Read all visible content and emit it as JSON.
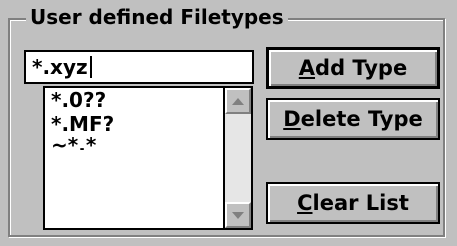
{
  "group": {
    "title": "User defined Filetypes"
  },
  "input": {
    "value": "*.xyz"
  },
  "list": {
    "items": [
      "*.0??",
      "*.MF?",
      "~*.*"
    ]
  },
  "buttons": {
    "add": {
      "mnemonic": "A",
      "rest": "dd Type"
    },
    "delete": {
      "mnemonic": "D",
      "rest": "elete Type"
    },
    "clear": {
      "mnemonic": "C",
      "rest": "lear List"
    }
  },
  "icons": {
    "scroll_up": "arrow-up",
    "scroll_down": "arrow-down"
  }
}
